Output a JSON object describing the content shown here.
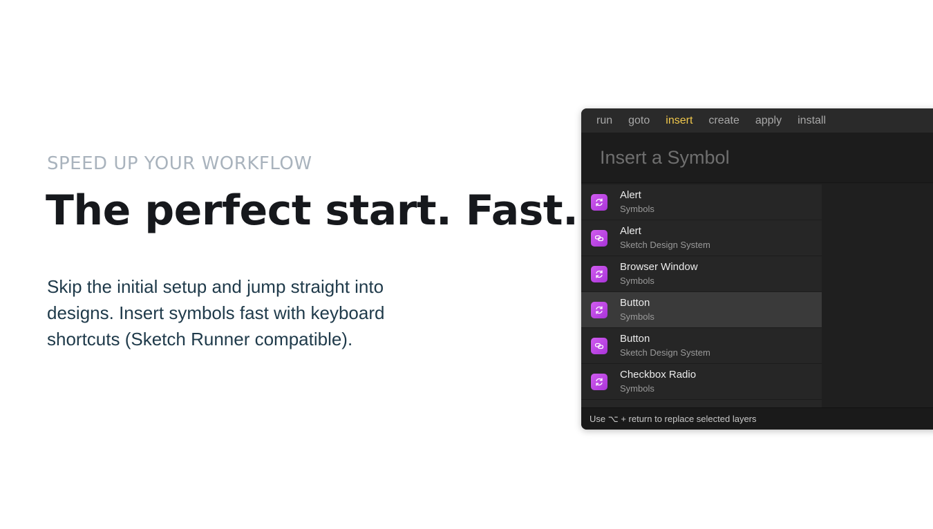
{
  "hero": {
    "eyebrow": "SPEED UP YOUR WORKFLOW",
    "headline": "The perfect start. Fast.",
    "body": "Skip the initial setup and jump straight into designs. Insert symbols fast with keyboard shortcuts (Sketch Runner compatible)."
  },
  "runner": {
    "tabs": [
      {
        "label": "run",
        "active": false
      },
      {
        "label": "goto",
        "active": false
      },
      {
        "label": "insert",
        "active": true
      },
      {
        "label": "create",
        "active": false
      },
      {
        "label": "apply",
        "active": false
      },
      {
        "label": "install",
        "active": false
      }
    ],
    "search_placeholder": "Insert a Symbol",
    "items": [
      {
        "name": "Alert",
        "source": "Symbols",
        "icon": "symbol-sync-icon"
      },
      {
        "name": "Alert",
        "source": "Sketch Design System",
        "icon": "library-link-icon"
      },
      {
        "name": "Browser Window",
        "source": "Symbols",
        "icon": "symbol-sync-icon"
      },
      {
        "name": "Button",
        "source": "Symbols",
        "icon": "symbol-sync-icon",
        "selected": true
      },
      {
        "name": "Button",
        "source": "Sketch Design System",
        "icon": "library-link-icon"
      },
      {
        "name": "Checkbox Radio",
        "source": "Symbols",
        "icon": "symbol-sync-icon"
      }
    ],
    "footer": "Use ⌥ + return to replace selected layers",
    "colors": {
      "active_tab": "#f2c94c",
      "icon_bg": "#c04be6"
    }
  }
}
